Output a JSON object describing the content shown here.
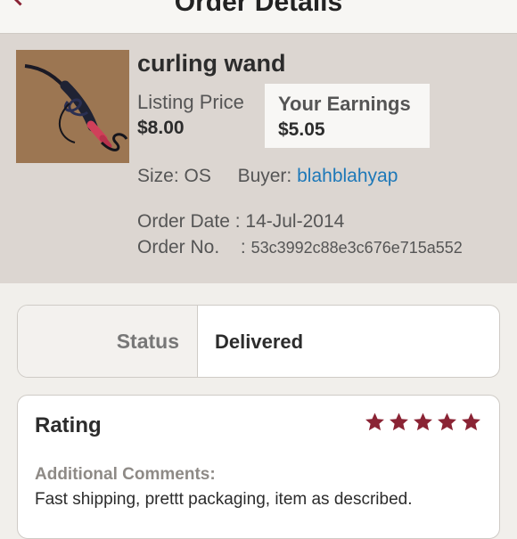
{
  "nav": {
    "title": "Order Details",
    "back_icon": "chevron-left-icon"
  },
  "colors": {
    "accent": "#8a2334",
    "link": "#1d78b8",
    "summary_bg": "#dcd6d1",
    "page_bg": "#f1efeb"
  },
  "item": {
    "title": "curling wand",
    "thumbnail": "curling-wand-photo",
    "listing_price_label": "Listing Price",
    "listing_price": "$8.00",
    "earnings_label": "Your Earnings",
    "earnings": "$5.05",
    "size_label": "Size:",
    "size": "OS",
    "buyer_label": "Buyer:",
    "buyer": "blahblahyap",
    "order_date_label": "Order Date :",
    "order_date": "14-Jul-2014",
    "order_no_label": "Order No.",
    "order_no_sep": ":",
    "order_no": "53c3992c88e3c676e715a552"
  },
  "status": {
    "label": "Status",
    "value": "Delivered"
  },
  "rating": {
    "heading": "Rating",
    "stars": 5,
    "max_stars": 5,
    "star_icon": "star-icon",
    "comments_label": "Additional Comments:",
    "comments": "Fast shipping, prettt packaging, item as described."
  }
}
